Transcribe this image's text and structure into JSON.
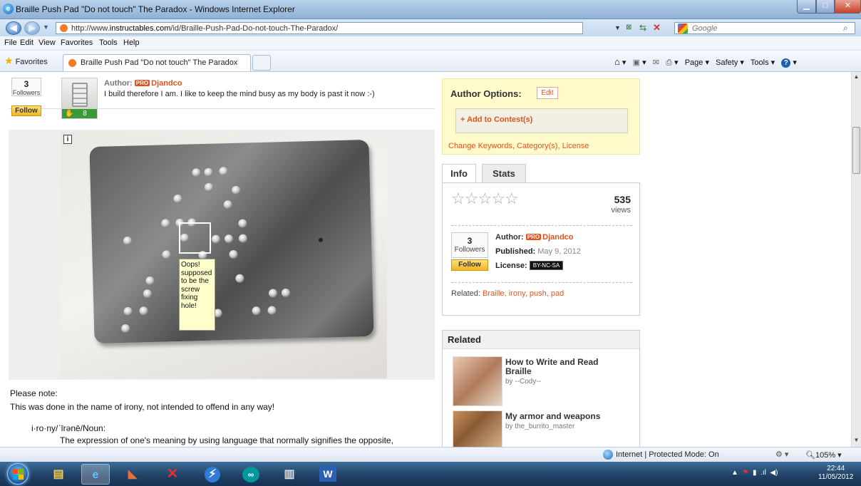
{
  "window": {
    "title": "Braille Push Pad \"Do not touch\" The Paradox - Windows Internet Explorer",
    "url_prefix": "http://www.",
    "url_domain": "instructables.com",
    "url_path": "/id/Braille-Push-Pad-Do-not-touch-The-Paradox/",
    "search_placeholder": "Google"
  },
  "menu": [
    "File",
    "Edit",
    "View",
    "Favorites",
    "Tools",
    "Help"
  ],
  "favorites_label": "Favorites",
  "tab_title": "Braille Push Pad \"Do not touch\" The Paradox",
  "commandbar": {
    "page": "Page ▾",
    "safety": "Safety ▾",
    "tools": "Tools ▾"
  },
  "author_box": {
    "followers_count": "3",
    "followers_label": "Followers",
    "follow_label": "Follow",
    "author_prefix": "Author:",
    "pro_badge": "PRO",
    "author_name": "Djandco",
    "bio": "I build therefore I am. I like to keep the mind busy as my body is past it now :-)",
    "avatar_count": "8"
  },
  "photo": {
    "info_icon": "i",
    "note": "Oops! supposed to be the screw fixing hole!"
  },
  "body": {
    "line1": "Please note:",
    "line2": "This was done in the name of irony, not intended to offend in any way!",
    "line3": "i·ro·ny/ˈīrənē/Noun:",
    "line4": "The expression of one's meaning by using language that normally signifies the opposite,"
  },
  "author_options": {
    "title": "Author Options:",
    "edit": "Edit",
    "add_contest": "+ Add to Contest(s)",
    "change_link": "Change Keywords, Category(s), License"
  },
  "info": {
    "tab_info": "Info",
    "tab_stats": "Stats",
    "views_count": "535",
    "views_label": "views",
    "followers_count": "3",
    "followers_label": "Followers",
    "author_prefix": "Author:",
    "pro_badge": "PRO",
    "author_name": "Djandco",
    "published_label": "Published:",
    "published_date": "May 9, 2012",
    "follow_label": "Follow",
    "license_label": "License:",
    "license_badge": "BY-NC-SA",
    "related_label": "Related:",
    "related_tags": "Braille, irony, push, pad"
  },
  "related": {
    "heading": "Related",
    "items": [
      {
        "title": "How to Write and Read Braille",
        "by": "by --Cody--"
      },
      {
        "title": "My armor and weapons",
        "by": "by the_burrito_master"
      }
    ]
  },
  "status": {
    "zone": "Internet | Protected Mode: On",
    "zoom": "105%"
  },
  "taskbar": {
    "time": "22:44",
    "date": "11/05/2012"
  },
  "colors": {
    "accent": "#e0541b",
    "follow": "#f2b51f",
    "author_options_bg": "#fffac9"
  }
}
